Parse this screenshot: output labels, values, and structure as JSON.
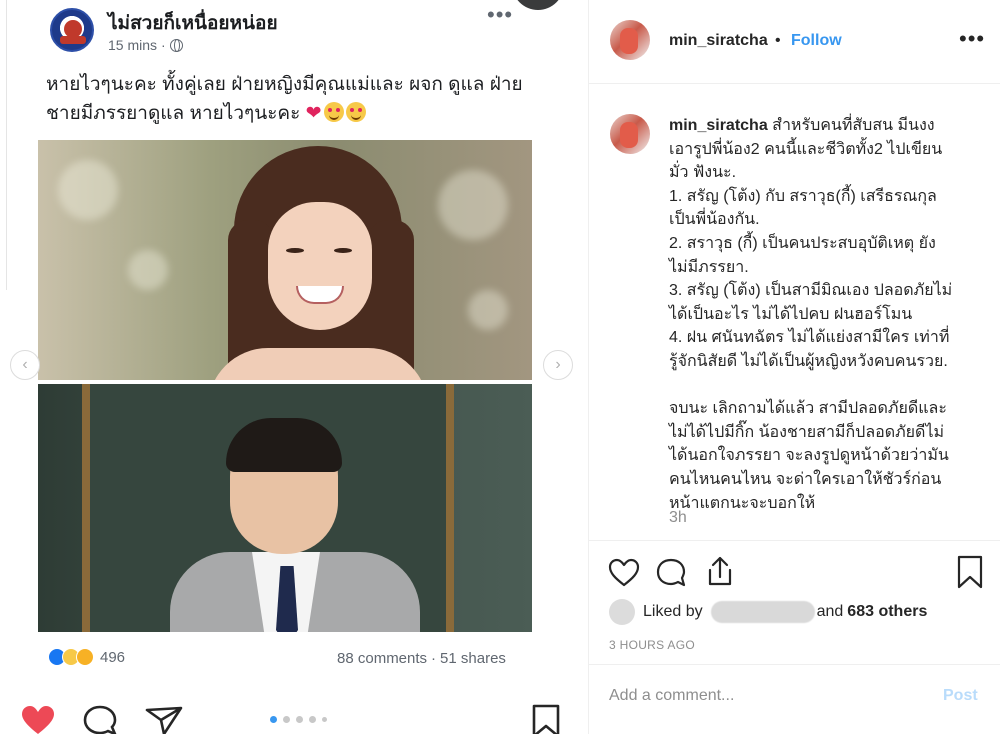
{
  "fb_post": {
    "page_name": "ไม่สวยก็เหนื่อยหน่อย",
    "time": "15 mins",
    "meta_separator": "·",
    "more": "•••",
    "caption_line1": "หายไวๆนะคะ ทั้งคู่เลย ฝ่ายหญิงมีคุณแม่และ ผจก ดูแล ฝ่าย",
    "caption_line2": "ชายมีภรรยาดูแล หายไวๆนะคะ",
    "caption_heart": "❤",
    "reaction_count": "496",
    "comments": "88 comments",
    "stat_separator": "·",
    "shares": "51 shares"
  },
  "carousel": {
    "prev_label": "‹",
    "next_label": "›",
    "dots": 5,
    "active_dot": 0
  },
  "header": {
    "username": "min_siratcha",
    "separator": "•",
    "follow_label": "Follow",
    "more": "•••"
  },
  "comment": {
    "username": "min_siratcha",
    "lines": [
      "สำหรับคนที่สับสน มีนงง",
      "เอารูปพี่น้อง2 คนนี้และชีวิตทั้ง2 ไปเขียน",
      "มั่ว ฟังนะ.",
      "1. สรัญ (โต้ง) กับ สราวุธ(กี้) เสรีธรณกุล",
      "เป็นพี่น้องกัน.",
      "2. สราวุธ (กี้) เป็นคนประสบอุบัติเหตุ ยัง",
      "ไม่มีภรรยา.",
      "3. สรัญ (โต้ง) เป็นสามีมิณเอง ปลอดภัยไม่",
      "ได้เป็นอะไร ไม่ได้ไปคบ ฝนฮอร์โมน",
      "4. ฝน ศนันทฉัตร ไม่ได้แย่งสามีใคร เท่าที่",
      "รู้จักนิสัยดี ไม่ได้เป็นผู้หญิงหวังคบคนรวย.",
      "",
      "จบนะ เลิกถามได้แล้ว สามีปลอดภัยดีและ",
      "ไม่ได้ไปมีกิ๊ก น้องชายสามีก็ปลอดภัยดีไม่",
      "ได้นอกใจภรรยา จะลงรูปดูหน้าด้วยว่ามัน",
      "คนไหนคนไหน จะด่าใครเอาให้ชัวร์ก่อน",
      "หน้าแตกนะจะบอกให้"
    ],
    "time": "3h"
  },
  "likes": {
    "prefix": "Liked by",
    "and_label": "and",
    "count_label": "683 others"
  },
  "post_age": "3 HOURS AGO",
  "add_comment": {
    "placeholder": "Add a comment...",
    "post_label": "Post"
  },
  "colors": {
    "accent": "#3897f0",
    "post_disabled": "#b9dcfb",
    "heart_active": "#ed4956",
    "text": "#262626",
    "muted": "#8e8e8e"
  },
  "icons": [
    "globe-icon",
    "heart-icon",
    "comment-icon",
    "share-icon",
    "bookmark-icon",
    "more-icon"
  ]
}
